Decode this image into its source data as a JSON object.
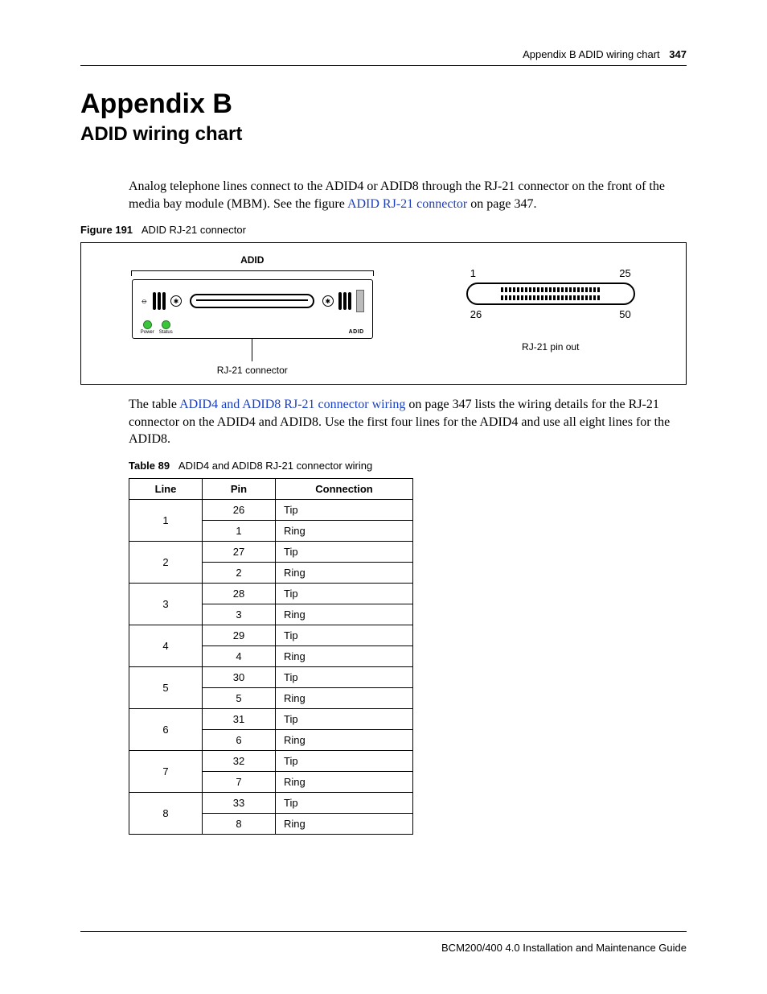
{
  "header": {
    "running": "Appendix B  ADID wiring chart",
    "page_number": "347"
  },
  "title": "Appendix B",
  "subtitle": "ADID wiring chart",
  "para1_a": "Analog telephone lines connect to the ADID4 or ADID8 through the RJ-21 connector on the front of the media bay module (MBM). See the figure ",
  "para1_link": "ADID RJ-21 connector",
  "para1_b": " on page 347.",
  "figure": {
    "caption_label": "Figure 191",
    "caption_text": "ADID RJ-21 connector",
    "module_label": "ADID",
    "led_power": "Power",
    "led_status": "Status",
    "adid_small": "ADID",
    "left_caption": "RJ-21 connector",
    "right_caption": "RJ-21 pin out",
    "pin_tl": "1",
    "pin_tr": "25",
    "pin_bl": "26",
    "pin_br": "50"
  },
  "para2_a": "The table ",
  "para2_link": "ADID4 and ADID8 RJ-21 connector wiring",
  "para2_b": " on page 347 lists the wiring details for the RJ-21 connector on the ADID4 and ADID8. Use the first four lines for the ADID4 and use all eight lines for the ADID8.",
  "table": {
    "caption_label": "Table 89",
    "caption_text": "ADID4 and ADID8 RJ-21 connector wiring",
    "headers": {
      "line": "Line",
      "pin": "Pin",
      "connection": "Connection"
    },
    "rows": [
      {
        "line": "1",
        "pairs": [
          {
            "pin": "26",
            "conn": "Tip"
          },
          {
            "pin": "1",
            "conn": "Ring"
          }
        ]
      },
      {
        "line": "2",
        "pairs": [
          {
            "pin": "27",
            "conn": "Tip"
          },
          {
            "pin": "2",
            "conn": "Ring"
          }
        ]
      },
      {
        "line": "3",
        "pairs": [
          {
            "pin": "28",
            "conn": "Tip"
          },
          {
            "pin": "3",
            "conn": "Ring"
          }
        ]
      },
      {
        "line": "4",
        "pairs": [
          {
            "pin": "29",
            "conn": "Tip"
          },
          {
            "pin": "4",
            "conn": "Ring"
          }
        ]
      },
      {
        "line": "5",
        "pairs": [
          {
            "pin": "30",
            "conn": "Tip"
          },
          {
            "pin": "5",
            "conn": "Ring"
          }
        ]
      },
      {
        "line": "6",
        "pairs": [
          {
            "pin": "31",
            "conn": "Tip"
          },
          {
            "pin": "6",
            "conn": "Ring"
          }
        ]
      },
      {
        "line": "7",
        "pairs": [
          {
            "pin": "32",
            "conn": "Tip"
          },
          {
            "pin": "7",
            "conn": "Ring"
          }
        ]
      },
      {
        "line": "8",
        "pairs": [
          {
            "pin": "33",
            "conn": "Tip"
          },
          {
            "pin": "8",
            "conn": "Ring"
          }
        ]
      }
    ]
  },
  "footer": "BCM200/400 4.0 Installation and Maintenance Guide"
}
